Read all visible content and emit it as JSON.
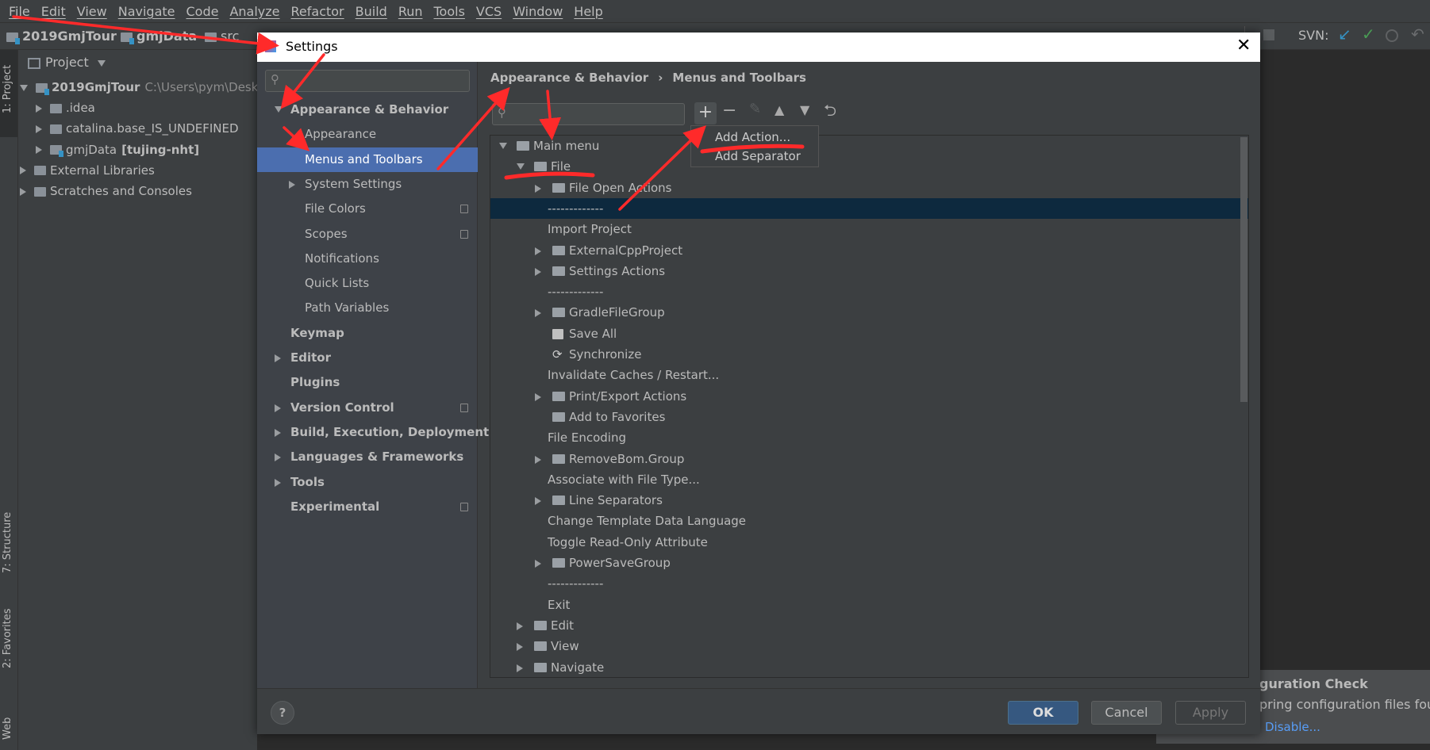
{
  "menubar": [
    "File",
    "Edit",
    "View",
    "Navigate",
    "Code",
    "Analyze",
    "Refactor",
    "Build",
    "Run",
    "Tools",
    "VCS",
    "Window",
    "Help"
  ],
  "navbar": {
    "crumbs": [
      "2019GmjTour",
      "gmjData",
      "src"
    ],
    "svn_label": "SVN:"
  },
  "toolstrip": {
    "project": "1: Project",
    "structure": "7: Structure",
    "favorites": "2: Favorites",
    "web": "Web"
  },
  "project_panel": {
    "title": "Project",
    "items": [
      {
        "label": "2019GmjTour",
        "extra": "C:\\Users\\pym\\Deskt",
        "bold": true,
        "level": 0,
        "expanded": true
      },
      {
        "label": ".idea",
        "level": 1
      },
      {
        "label": "catalina.base_IS_UNDEFINED",
        "level": 1
      },
      {
        "label": "gmjData",
        "extra": "[tujing-nht]",
        "level": 1
      },
      {
        "label": "External Libraries",
        "level": 0
      },
      {
        "label": "Scratches and Consoles",
        "level": 0
      }
    ]
  },
  "dialog": {
    "title": "Settings",
    "breadcrumb": [
      "Appearance & Behavior",
      "Menus and Toolbars"
    ],
    "left_items": [
      {
        "label": "Appearance & Behavior",
        "bold": true,
        "level": 0,
        "arrow": "down"
      },
      {
        "label": "Appearance",
        "level": 1
      },
      {
        "label": "Menus and Toolbars",
        "level": 1,
        "selected": true
      },
      {
        "label": "System Settings",
        "level": 1,
        "arrow": "right"
      },
      {
        "label": "File Colors",
        "level": 1,
        "copy": true
      },
      {
        "label": "Scopes",
        "level": 1,
        "copy": true
      },
      {
        "label": "Notifications",
        "level": 1
      },
      {
        "label": "Quick Lists",
        "level": 1
      },
      {
        "label": "Path Variables",
        "level": 1
      },
      {
        "label": "Keymap",
        "bold": true,
        "level": 0
      },
      {
        "label": "Editor",
        "bold": true,
        "level": 0,
        "arrow": "right"
      },
      {
        "label": "Plugins",
        "bold": true,
        "level": 0
      },
      {
        "label": "Version Control",
        "bold": true,
        "level": 0,
        "arrow": "right",
        "copy": true
      },
      {
        "label": "Build, Execution, Deployment",
        "bold": true,
        "level": 0,
        "arrow": "right"
      },
      {
        "label": "Languages & Frameworks",
        "bold": true,
        "level": 0,
        "arrow": "right"
      },
      {
        "label": "Tools",
        "bold": true,
        "level": 0,
        "arrow": "right"
      },
      {
        "label": "Experimental",
        "bold": true,
        "level": 0,
        "copy": true
      }
    ],
    "tree": [
      {
        "label": "Main menu",
        "level": 0,
        "arrow": "down",
        "icon": "folder"
      },
      {
        "label": "File",
        "level": 1,
        "arrow": "down",
        "icon": "folder"
      },
      {
        "label": "File Open Actions",
        "level": 2,
        "arrow": "right",
        "icon": "folder"
      },
      {
        "label": "-------------",
        "level": 2,
        "selected": true
      },
      {
        "label": "Import Project",
        "level": 2
      },
      {
        "label": "ExternalCppProject",
        "level": 2,
        "arrow": "right",
        "icon": "folder"
      },
      {
        "label": "Settings Actions",
        "level": 2,
        "arrow": "right",
        "icon": "folder"
      },
      {
        "label": "-------------",
        "level": 2
      },
      {
        "label": "GradleFileGroup",
        "level": 2,
        "arrow": "right",
        "icon": "folder"
      },
      {
        "label": "Save All",
        "level": 2,
        "icon": "save"
      },
      {
        "label": "Synchronize",
        "level": 2,
        "icon": "sync"
      },
      {
        "label": "Invalidate Caches / Restart...",
        "level": 2
      },
      {
        "label": "Print/Export Actions",
        "level": 2,
        "arrow": "right",
        "icon": "folder"
      },
      {
        "label": "Add to Favorites",
        "level": 2,
        "icon": "folder"
      },
      {
        "label": "File Encoding",
        "level": 2
      },
      {
        "label": "RemoveBom.Group",
        "level": 2,
        "arrow": "right",
        "icon": "folder"
      },
      {
        "label": "Associate with File Type...",
        "level": 2
      },
      {
        "label": "Line Separators",
        "level": 2,
        "arrow": "right",
        "icon": "folder"
      },
      {
        "label": "Change Template Data Language",
        "level": 2
      },
      {
        "label": "Toggle Read-Only Attribute",
        "level": 2
      },
      {
        "label": "PowerSaveGroup",
        "level": 2,
        "arrow": "right",
        "icon": "folder"
      },
      {
        "label": "-------------",
        "level": 2
      },
      {
        "label": "Exit",
        "level": 2
      },
      {
        "label": "Edit",
        "level": 1,
        "arrow": "right",
        "icon": "folder"
      },
      {
        "label": "View",
        "level": 1,
        "arrow": "right",
        "icon": "folder"
      },
      {
        "label": "Navigate",
        "level": 1,
        "arrow": "right",
        "icon": "folder"
      }
    ],
    "popup": {
      "add_action": "Add Action...",
      "add_separator": "Add Separator"
    },
    "buttons": {
      "ok": "OK",
      "cancel": "Cancel",
      "apply": "Apply",
      "help": "?"
    }
  },
  "notification": {
    "title": "guration Check",
    "body": "pring configuration files foun",
    "link": "Disable..."
  },
  "colors": {
    "selection": "#4b6eaf",
    "tree_selection": "#0d293e",
    "annotation": "#ff2a2a",
    "link": "#589df6"
  }
}
